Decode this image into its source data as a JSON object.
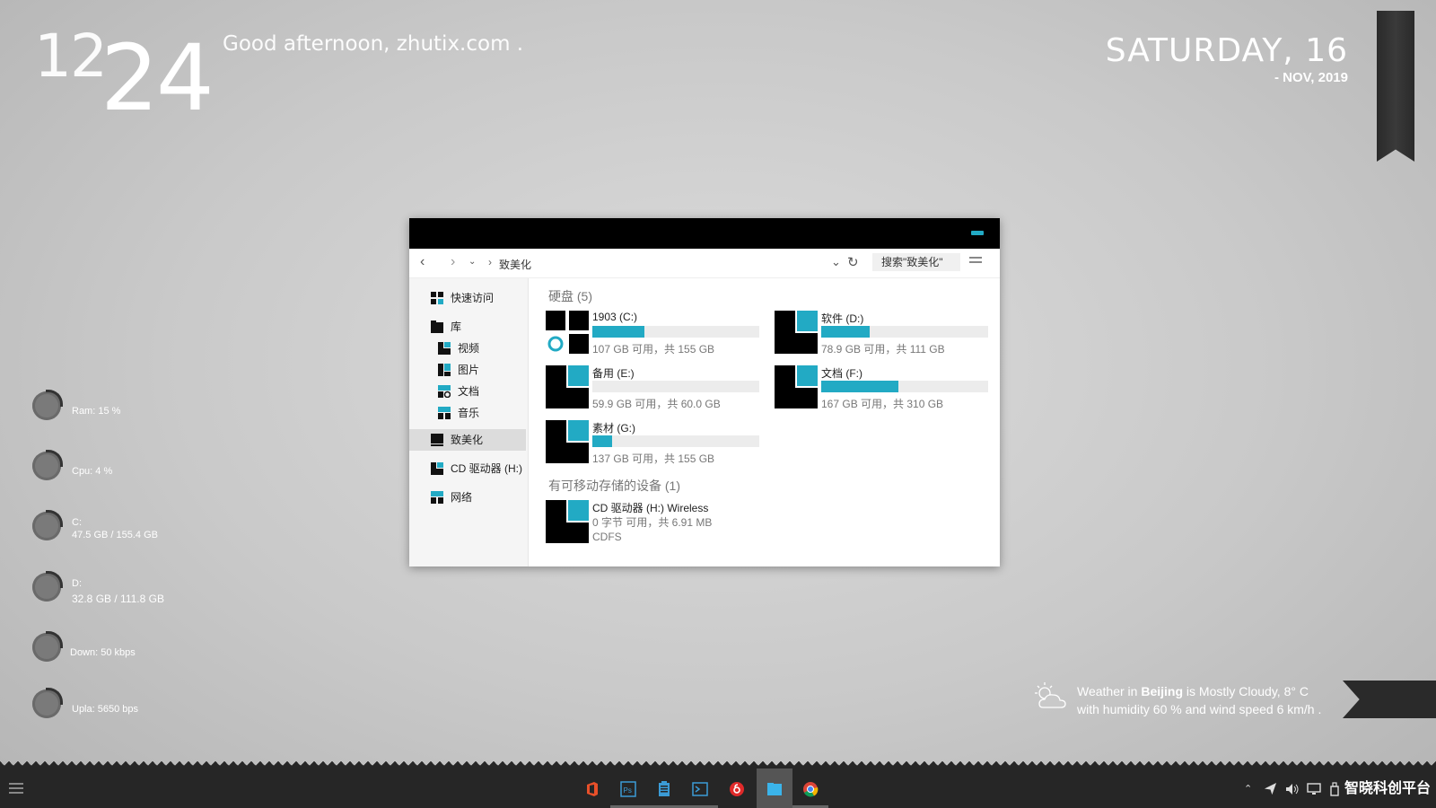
{
  "desktop": {
    "clock_hours": "12",
    "clock_minutes": "24",
    "greeting": "Good afternoon, zhutix.com .",
    "date_day": "SATURDAY, 16",
    "date_sub": "- NOV, 2019"
  },
  "meters": [
    {
      "line1": "Ram: 15 %",
      "line2": ""
    },
    {
      "line1": "Cpu: 4 %",
      "line2": ""
    },
    {
      "line1": "C:",
      "line2": "47.5 GB / 155.4 GB"
    },
    {
      "line1": "D:",
      "line2": "32.8 GB / 111.8 GB"
    },
    {
      "line1": "Down: 50 kbps",
      "line2": ""
    },
    {
      "line1": "Upla: 5650 bps",
      "line2": ""
    }
  ],
  "explorer": {
    "path": "致美化",
    "search_placeholder": "搜索\"致美化\"",
    "sidebar": [
      {
        "label": "快速访问"
      },
      {
        "label": "库"
      },
      {
        "label": "视频"
      },
      {
        "label": "图片"
      },
      {
        "label": "文档"
      },
      {
        "label": "音乐"
      },
      {
        "label": "致美化"
      },
      {
        "label": "CD 驱动器 (H:)"
      },
      {
        "label": "网络"
      }
    ],
    "section_drives": "硬盘 (5)",
    "section_removable": "有可移动存储的设备 (1)",
    "drives": [
      {
        "name": "1903 (C:)",
        "info": "107 GB 可用，共 155 GB",
        "used_fraction": 0.31
      },
      {
        "name": "软件 (D:)",
        "info": "78.9 GB 可用，共 111 GB",
        "used_fraction": 0.29
      },
      {
        "name": "备用 (E:)",
        "info": "59.9 GB 可用，共 60.0 GB",
        "used_fraction": 0.0
      },
      {
        "name": "文档 (F:)",
        "info": "167 GB 可用，共 310 GB",
        "used_fraction": 0.46
      },
      {
        "name": "素材 (G:)",
        "info": "137 GB 可用，共 155 GB",
        "used_fraction": 0.12
      }
    ],
    "removable": {
      "name": "CD 驱动器 (H:) Wireless",
      "info": "0 字节 可用，共 6.91 MB",
      "fs": "CDFS"
    }
  },
  "weather": {
    "prefix": "Weather in ",
    "city": "Beijing",
    "condition": " is Mostly Cloudy, 8° C",
    "line2": "with humidity 60 % and wind speed 6 km/h ."
  },
  "taskbar": {
    "watermark": "智晓科创平台"
  },
  "colors": {
    "accent": "#22aac4",
    "taskbar": "#262626"
  }
}
